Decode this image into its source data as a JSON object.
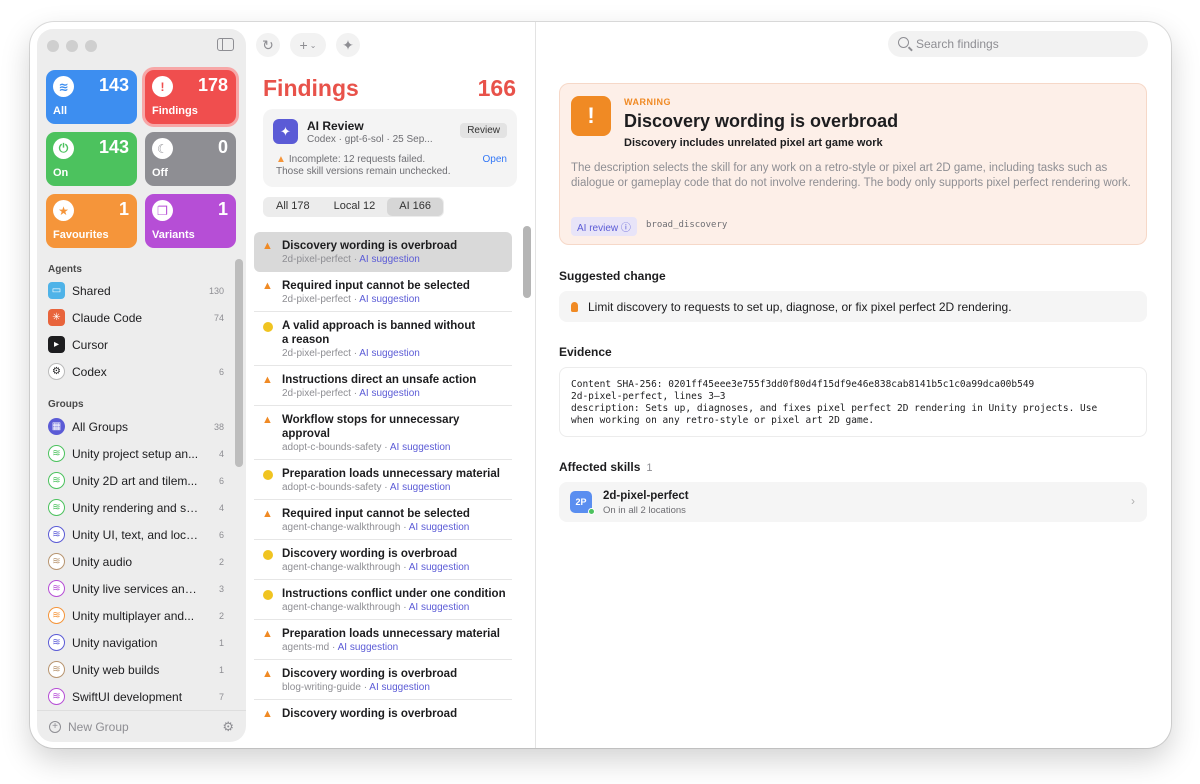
{
  "sidebar": {
    "tiles": {
      "all": {
        "label": "All",
        "count": "143",
        "icon": "layers-icon"
      },
      "findings": {
        "label": "Findings",
        "count": "178",
        "icon": "warning-icon"
      },
      "on": {
        "label": "On",
        "count": "143",
        "icon": "power-icon"
      },
      "off": {
        "label": "Off",
        "count": "0",
        "icon": "moon-icon"
      },
      "favourites": {
        "label": "Favourites",
        "count": "1",
        "icon": "star-icon"
      },
      "variants": {
        "label": "Variants",
        "count": "1",
        "icon": "copy-icon"
      }
    },
    "agents_title": "Agents",
    "agents": [
      {
        "label": "Shared",
        "count": "130",
        "color": "#4fb3e8"
      },
      {
        "label": "Claude Code",
        "count": "74",
        "color": "#e8643c"
      },
      {
        "label": "Cursor",
        "count": "",
        "color": "#1d1d1f"
      },
      {
        "label": "Codex",
        "count": "6",
        "color": "#ffffff"
      }
    ],
    "groups_title": "Groups",
    "groups": [
      {
        "label": "All Groups",
        "count": "38",
        "color": "#5b5bd6"
      },
      {
        "label": "Unity project setup an...",
        "count": "4",
        "color": "#4cc25e"
      },
      {
        "label": "Unity 2D art and tilem...",
        "count": "6",
        "color": "#4cc25e"
      },
      {
        "label": "Unity rendering and sh...",
        "count": "4",
        "color": "#4cc25e"
      },
      {
        "label": "Unity UI, text, and loca...",
        "count": "6",
        "color": "#5b5bd6"
      },
      {
        "label": "Unity audio",
        "count": "2",
        "color": "#b89570"
      },
      {
        "label": "Unity live services and...",
        "count": "3",
        "color": "#b64ed6"
      },
      {
        "label": "Unity multiplayer and...",
        "count": "2",
        "color": "#f5953a"
      },
      {
        "label": "Unity navigation",
        "count": "1",
        "color": "#5b5bd6"
      },
      {
        "label": "Unity web builds",
        "count": "1",
        "color": "#b89570"
      },
      {
        "label": "SwiftUI development",
        "count": "7",
        "color": "#b64ed6"
      }
    ],
    "new_group_label": "New Group"
  },
  "middle": {
    "title": "Findings",
    "count": "166",
    "ai_card": {
      "title": "AI Review",
      "subtitle": "Codex · gpt-6-sol · 25 Sep...",
      "review_label": "Review",
      "warning": "Incomplete: 12 requests failed. Those skill versions remain unchecked.",
      "open_label": "Open"
    },
    "segments": [
      "All 178",
      "Local 12",
      "AI 166"
    ],
    "rows": [
      {
        "title": "Discovery wording is overbroad",
        "skill": "2d-pixel-perfect",
        "tag": "AI suggestion",
        "severity": "warning"
      },
      {
        "title": "Required input cannot be selected",
        "skill": "2d-pixel-perfect",
        "tag": "AI suggestion",
        "severity": "warning"
      },
      {
        "title": "A valid approach is banned without a reason",
        "skill": "2d-pixel-perfect",
        "tag": "AI suggestion",
        "severity": "caution"
      },
      {
        "title": "Instructions direct an unsafe action",
        "skill": "2d-pixel-perfect",
        "tag": "AI suggestion",
        "severity": "warning"
      },
      {
        "title": "Workflow stops for unnecessary approval",
        "skill": "adopt-c-bounds-safety",
        "tag": "AI suggestion",
        "severity": "warning"
      },
      {
        "title": "Preparation loads unnecessary material",
        "skill": "adopt-c-bounds-safety",
        "tag": "AI suggestion",
        "severity": "caution"
      },
      {
        "title": "Required input cannot be selected",
        "skill": "agent-change-walkthrough",
        "tag": "AI suggestion",
        "severity": "warning"
      },
      {
        "title": "Discovery wording is overbroad",
        "skill": "agent-change-walkthrough",
        "tag": "AI suggestion",
        "severity": "caution"
      },
      {
        "title": "Instructions conflict under one condition",
        "skill": "agent-change-walkthrough",
        "tag": "AI suggestion",
        "severity": "caution"
      },
      {
        "title": "Preparation loads unnecessary material",
        "skill": "agents-md",
        "tag": "AI suggestion",
        "severity": "warning"
      },
      {
        "title": "Discovery wording is overbroad",
        "skill": "blog-writing-guide",
        "tag": "AI suggestion",
        "severity": "warning"
      },
      {
        "title": "Discovery wording is overbroad",
        "skill": "",
        "tag": "",
        "severity": "warning"
      }
    ]
  },
  "detail": {
    "search_placeholder": "Search findings",
    "severity_label": "WARNING",
    "title": "Discovery wording is overbroad",
    "subtitle": "Discovery includes unrelated pixel art game work",
    "description": "The description selects the skill for any work on a retro-style or pixel art 2D game, including tasks such as dialogue or gameplay code that do not involve rendering. The body only supports pixel perfect rendering work.",
    "badge": "AI review ⓘ",
    "code": "broad_discovery",
    "suggested_label": "Suggested change",
    "suggested_text": "Limit discovery to requests to set up, diagnose, or fix pixel perfect 2D rendering.",
    "evidence_label": "Evidence",
    "evidence_text": "Content SHA-256: 0201ff45eee3e755f3dd0f80d4f15df9e46e838cab8141b5c1c0a99dca00b549\n2d-pixel-perfect, lines 3–3\ndescription: Sets up, diagnoses, and fixes pixel perfect 2D rendering in Unity projects. Use\nwhen working on any retro-style or pixel art 2D game.",
    "affected_label": "Affected skills",
    "affected_count": "1",
    "skill": {
      "avatar": "2P",
      "name": "2d-pixel-perfect",
      "locations": "On in all 2 locations"
    }
  }
}
